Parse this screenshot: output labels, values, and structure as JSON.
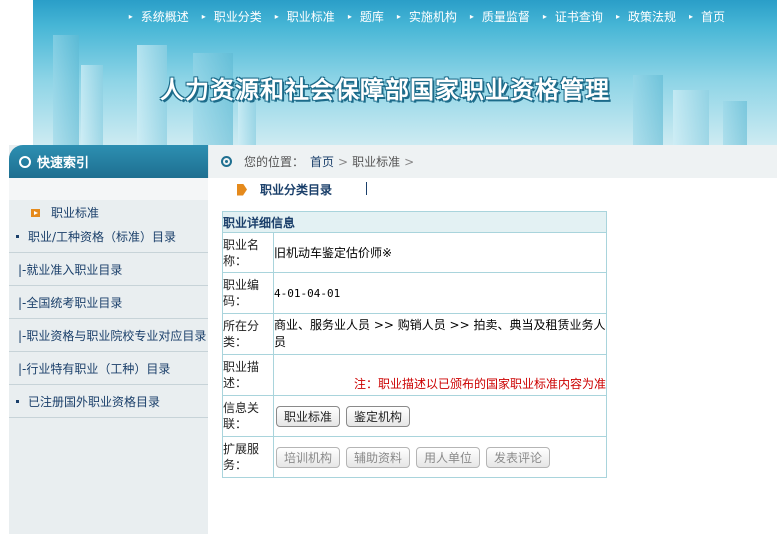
{
  "topnav": [
    "系统概述",
    "职业分类",
    "职业标准",
    "题库",
    "实施机构",
    "质量监督",
    "证书查询",
    "政策法规",
    "首页"
  ],
  "banner": {
    "title": "人力资源和社会保障部国家职业资格管理"
  },
  "sidebar": {
    "title": "快速索引",
    "top_link": "职业标准",
    "items": [
      "职业/工种资格（标准）目录",
      "|-就业准入职业目录",
      "|-全国统考职业目录",
      "|-职业资格与职业院校专业对应目录",
      "|-行业特有职业（工种）目录",
      "已注册国外职业资格目录"
    ]
  },
  "breadcrumb": {
    "label": "您的位置：",
    "home": "首页",
    "sep": ">",
    "current": "职业标准",
    "trail": ">"
  },
  "section": {
    "title": "职业分类目录"
  },
  "detail": {
    "header": "职业详细信息",
    "name_label": "职业名称：",
    "name": "旧机动车鉴定估价师※",
    "code_label": "职业编码：",
    "code": "4-01-04-01",
    "category_label": "所在分类：",
    "category": "商业、服务业人员 >> 购销人员 >> 拍卖、典当及租赁业务人员",
    "desc_label": "职业描述：",
    "desc_note": "注：职业描述以已颁布的国家职业标准内容为准",
    "related_label": "信息关联：",
    "related_buttons": [
      "职业标准",
      "鉴定机构"
    ],
    "ext_label": "扩展服务：",
    "ext_buttons": [
      "培训机构",
      "辅助资料",
      "用人单位",
      "发表评论"
    ]
  }
}
